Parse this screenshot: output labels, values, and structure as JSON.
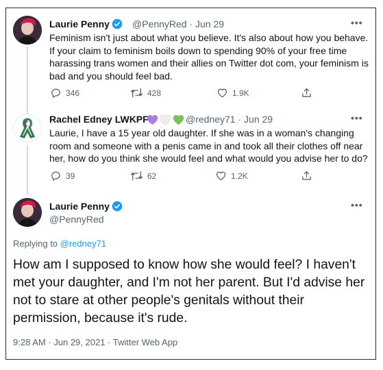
{
  "tweet1": {
    "name": "Laurie Penny",
    "handle": "@PennyRed",
    "date": "Jun 29",
    "sep": "·",
    "text": "Feminism isn't just about what you believe. It's also about how you behave. If your claim to feminism boils down to spending 90% of your free time harassing trans women and their allies on Twitter dot com, your feminism is bad and you should feel bad.",
    "replies": "346",
    "retweets": "428",
    "likes": "1.9K"
  },
  "tweet2": {
    "name": "Rachel Edney LWKPF",
    "handle": "@redney71",
    "date": "Jun 29",
    "sep": "·",
    "text": "Laurie, I have a 15 year old daughter. If she was in a woman's changing room and someone with a penis came in  and took all their clothes off near her, how do you think she would feel and what would you advise her to do?",
    "replies": "39",
    "retweets": "62",
    "likes": "1.2K",
    "heart_colors": [
      "#ab7fe0",
      "#eeeeee",
      "#78c25e"
    ]
  },
  "main_tweet": {
    "name": "Laurie Penny",
    "handle": "@PennyRed",
    "replying_prefix": "Replying to",
    "replying_handle": "@redney71",
    "text": "How am I supposed to know how she would feel? I haven't met your daughter, and I'm not her parent. But I'd advise her not to stare at other people's genitals without their permission, because it's rude.",
    "timestamp": "9:28 AM · Jun 29, 2021 · Twitter Web App"
  },
  "icons": {
    "more": "more-icon",
    "verified": "verified-badge-icon",
    "reply": "reply-icon",
    "retweet": "retweet-icon",
    "like": "heart-icon",
    "share": "share-icon"
  },
  "colors": {
    "accent": "#1d9bf0",
    "muted": "#536471",
    "text": "#0f1419"
  },
  "more_label": "•••"
}
